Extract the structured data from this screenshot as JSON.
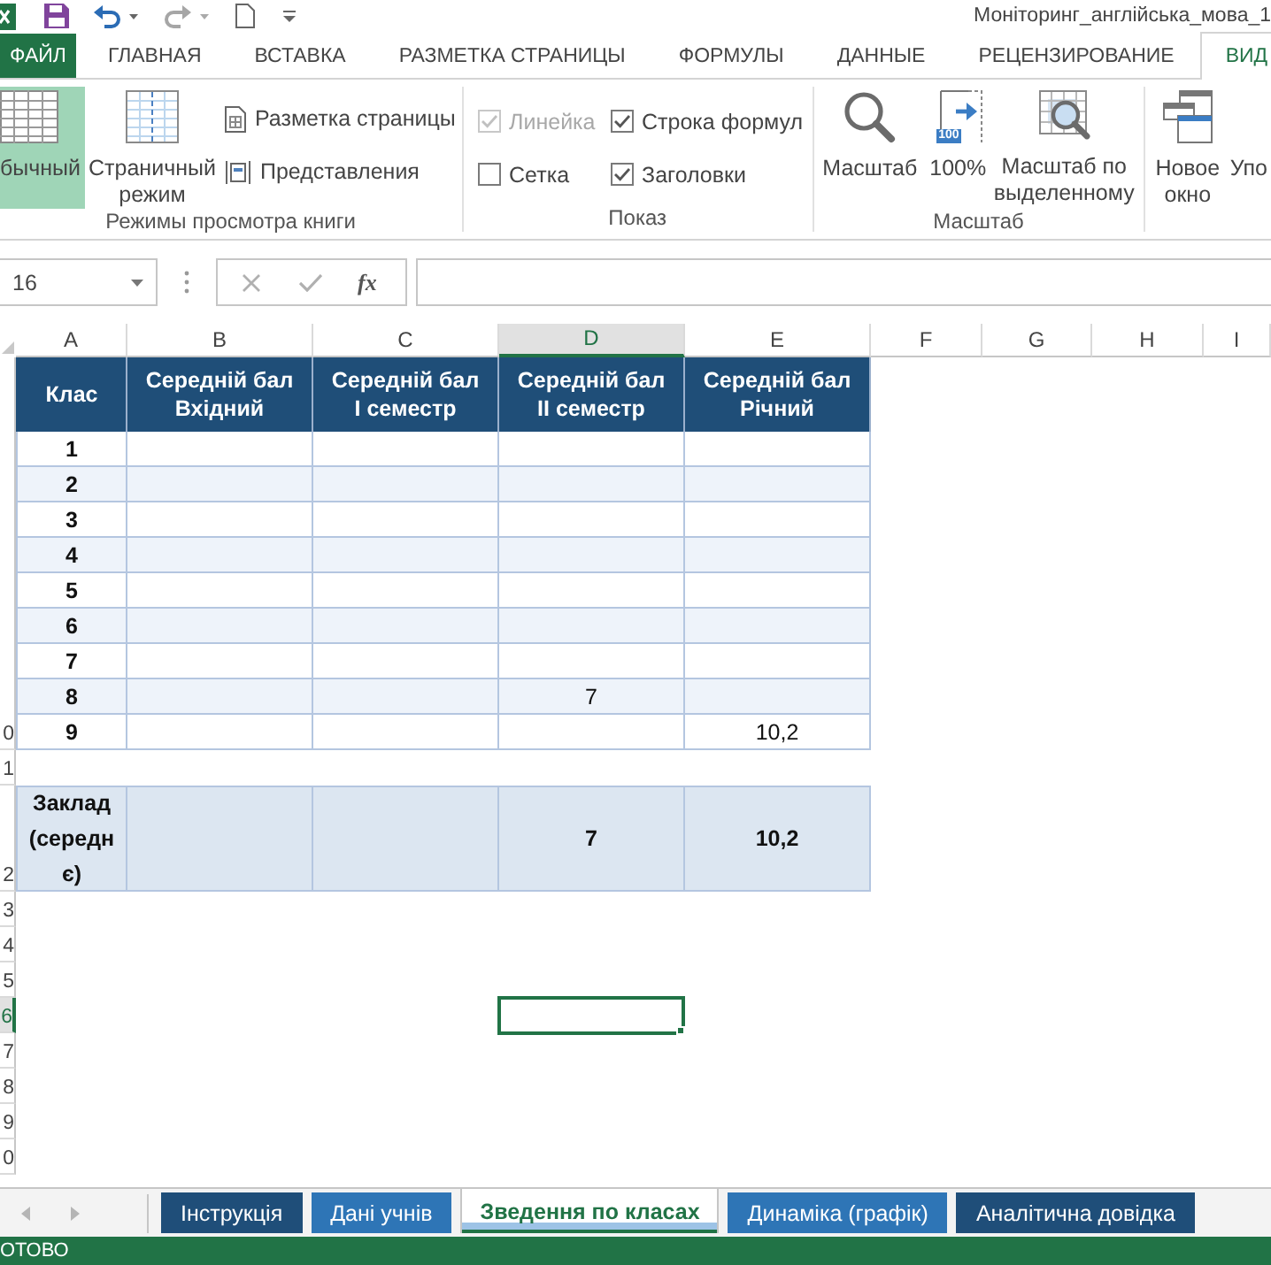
{
  "quick_access": {
    "undo": {
      "disabled": false
    },
    "redo": {
      "disabled": true
    }
  },
  "title_bar": {
    "title": "Моніторинг_англійська_мова_1"
  },
  "ribbon_tabs": [
    {
      "label": "ФАЙЛ",
      "kind": "file",
      "selected": false
    },
    {
      "label": "ГЛАВНАЯ",
      "kind": "tab",
      "selected": false
    },
    {
      "label": "ВСТАВКА",
      "kind": "tab",
      "selected": false
    },
    {
      "label": "РАЗМЕТКА СТРАНИЦЫ",
      "kind": "tab",
      "selected": false
    },
    {
      "label": "ФОРМУЛЫ",
      "kind": "tab",
      "selected": false
    },
    {
      "label": "ДАННЫЕ",
      "kind": "tab",
      "selected": false
    },
    {
      "label": "РЕЦЕНЗИРОВАНИЕ",
      "kind": "tab",
      "selected": false
    },
    {
      "label": "ВИД",
      "kind": "tab",
      "selected": true
    }
  ],
  "ribbon": {
    "views": {
      "label": "Режимы просмотра книги",
      "buttons": [
        {
          "label": "бычный",
          "selected": true
        },
        {
          "label": "Страничный режим",
          "selected": false
        },
        {
          "label": "Разметка страницы",
          "selected": false
        },
        {
          "label": "Представления",
          "selected": false
        }
      ]
    },
    "show": {
      "label": "Показ",
      "options": [
        {
          "label": "Линейка",
          "checked": true,
          "disabled": true
        },
        {
          "label": "Строка формул",
          "checked": true,
          "disabled": false
        },
        {
          "label": "Сетка",
          "checked": false,
          "disabled": false
        },
        {
          "label": "Заголовки",
          "checked": true,
          "disabled": false
        }
      ]
    },
    "zoom": {
      "label": "Масштаб",
      "buttons": [
        {
          "label": "Масштаб"
        },
        {
          "label": "100%",
          "badge": "100"
        },
        {
          "label": "Масштаб по выделенному"
        }
      ]
    },
    "window": {
      "buttons": [
        {
          "label": "Новое окно"
        },
        {
          "label": "Упо"
        }
      ]
    }
  },
  "formula_bar": {
    "name_box": "16",
    "function_label": "fx"
  },
  "sheet": {
    "column_headers": [
      {
        "label": "A",
        "selected": false
      },
      {
        "label": "B",
        "selected": false
      },
      {
        "label": "C",
        "selected": false
      },
      {
        "label": "D",
        "selected": true
      },
      {
        "label": "E",
        "selected": false
      },
      {
        "label": "F",
        "selected": false
      },
      {
        "label": "G",
        "selected": false
      },
      {
        "label": "H",
        "selected": false
      },
      {
        "label": "I",
        "selected": false
      }
    ],
    "row_headers": [
      {
        "label": "0",
        "selected": false
      },
      {
        "label": "1",
        "selected": false
      },
      {
        "label": "2",
        "selected": false
      },
      {
        "label": "3",
        "selected": false
      },
      {
        "label": "4",
        "selected": false
      },
      {
        "label": "5",
        "selected": false
      },
      {
        "label": "6",
        "selected": true
      },
      {
        "label": "7",
        "selected": false
      },
      {
        "label": "8",
        "selected": false
      },
      {
        "label": "9",
        "selected": false
      },
      {
        "label": "0",
        "selected": false
      }
    ],
    "table": {
      "columns": [
        "Клас",
        "Середній бал Вхідний",
        "Середній бал І семестр",
        "Середній бал ІІ семестр",
        "Середній бал Річний"
      ],
      "rows": [
        {
          "class": "1"
        },
        {
          "class": "2"
        },
        {
          "class": "3"
        },
        {
          "class": "4"
        },
        {
          "class": "5"
        },
        {
          "class": "6"
        },
        {
          "class": "7"
        },
        {
          "class": "8",
          "semester_2": "7"
        },
        {
          "class": "9",
          "annual": "10,2"
        }
      ],
      "total": {
        "class": "Заклад (середнє)",
        "semester_2": "7",
        "annual": "10,2"
      }
    }
  },
  "sheet_tabs": [
    {
      "label": "Інструкція",
      "color": "#1f4e79",
      "selected": false
    },
    {
      "label": "Дані учнів",
      "color": "#2e75b6",
      "selected": false
    },
    {
      "label": "Зведення по класах",
      "color": "#9dc3e6",
      "selected": true
    },
    {
      "label": "Динаміка (графік)",
      "color": "#2e75b6",
      "selected": false
    },
    {
      "label": "Аналітична довідка",
      "color": "#1f4e79",
      "selected": false
    }
  ],
  "status_bar": {
    "text": "ОТОВО"
  }
}
